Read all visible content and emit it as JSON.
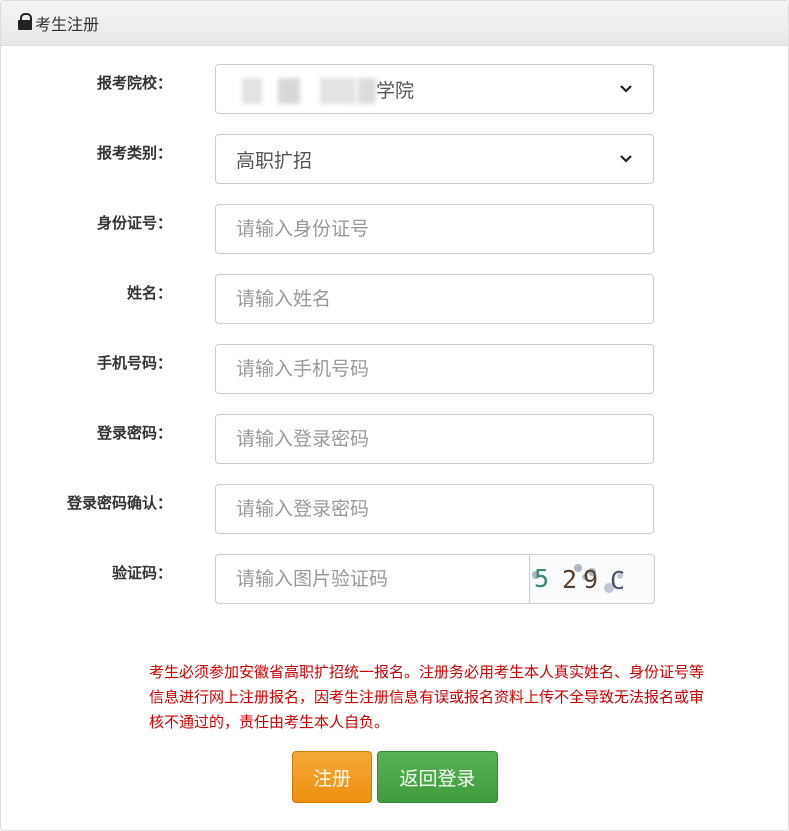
{
  "header": {
    "title": "考生注册",
    "icon": "lock-icon"
  },
  "form": {
    "school": {
      "label": "报考院校：",
      "value_visible": "学院"
    },
    "category": {
      "label": "报考类别：",
      "value": "高职扩招"
    },
    "id_number": {
      "label": "身份证号：",
      "placeholder": "请输入身份证号"
    },
    "name": {
      "label": "姓名：",
      "placeholder": "请输入姓名"
    },
    "phone": {
      "label": "手机号码：",
      "placeholder": "请输入手机号码"
    },
    "password": {
      "label": "登录密码：",
      "placeholder": "请输入登录密码"
    },
    "password_confirm": {
      "label": "登录密码确认：",
      "placeholder": "请输入登录密码"
    },
    "captcha": {
      "label": "验证码：",
      "placeholder": "请输入图片验证码",
      "code": "529C"
    }
  },
  "notice": "考生必须参加安徽省高职扩招统一报名。注册务必用考生本人真实姓名、身份证号等信息进行网上注册报名，因考生注册信息有误或报名资料上传不全导致无法报名或审核不通过的，责任由考生本人自负。",
  "buttons": {
    "register": "注册",
    "back_login": "返回登录"
  },
  "colors": {
    "notice": "#cc0000",
    "register_button": "#f0981e",
    "back_button": "#4aa747"
  }
}
